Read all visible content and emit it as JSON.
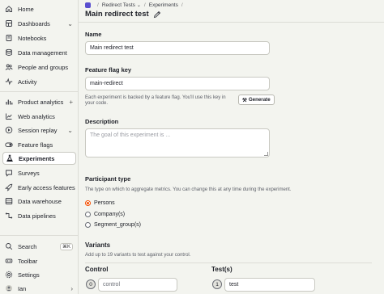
{
  "sidebar": {
    "items": [
      {
        "label": "Home",
        "icon": "home-icon"
      },
      {
        "label": "Dashboards",
        "icon": "dashboard-icon",
        "trail": "⌄"
      },
      {
        "label": "Notebooks",
        "icon": "notebook-icon"
      },
      {
        "label": "Data management",
        "icon": "database-icon"
      },
      {
        "label": "People and groups",
        "icon": "people-icon"
      },
      {
        "label": "Activity",
        "icon": "activity-icon"
      },
      {
        "label": "Product analytics",
        "icon": "chart-icon",
        "trail": "+"
      },
      {
        "label": "Web analytics",
        "icon": "web-analytics-icon"
      },
      {
        "label": "Session replay",
        "icon": "replay-icon",
        "trail": "⌄"
      },
      {
        "label": "Feature flags",
        "icon": "toggle-icon"
      },
      {
        "label": "Experiments",
        "icon": "flask-icon"
      },
      {
        "label": "Surveys",
        "icon": "survey-icon"
      },
      {
        "label": "Early access features",
        "icon": "rocket-icon"
      },
      {
        "label": "Data warehouse",
        "icon": "warehouse-icon"
      },
      {
        "label": "Data pipelines",
        "icon": "pipeline-icon"
      }
    ],
    "bottom": [
      {
        "label": "Search",
        "icon": "search-icon",
        "shortcut": "⌘K"
      },
      {
        "label": "Toolbar",
        "icon": "toolbar-icon"
      },
      {
        "label": "Settings",
        "icon": "gear-icon"
      },
      {
        "label": "Ian",
        "icon": "avatar-icon",
        "trail": "›"
      }
    ]
  },
  "breadcrumb": {
    "project": "Redirect Tests",
    "section": "Experiments",
    "trailing_sep": "/",
    "sep": "/"
  },
  "page": {
    "title": "Main redirect test"
  },
  "form": {
    "name_label": "Name",
    "name_value": "Main redirect test",
    "flag_label": "Feature flag key",
    "flag_value": "main-redirect",
    "flag_help_1": "Each experiment is backed by a feature flag. You'll use this key in",
    "flag_help_2": "your code.",
    "generate_label": "Generate",
    "description_label": "Description",
    "description_placeholder": "The goal of this experiment is ...",
    "participant_label": "Participant type",
    "participant_help": "The type on which to aggregate metrics. You can change this at any time during the experiment.",
    "participant_options": [
      "Persons",
      "Company(s)",
      "Segment_group(s)"
    ],
    "participant_selected": "Persons",
    "variants_label": "Variants",
    "variants_help": "Add up to 19 variants to test against your control.",
    "control_head": "Control",
    "control_index": "0",
    "control_value": "control",
    "test_head": "Test(s)",
    "test_index": "1",
    "test_value": "test"
  },
  "colors": {
    "accent": "#f54e00",
    "background": "#f3f4ef"
  }
}
